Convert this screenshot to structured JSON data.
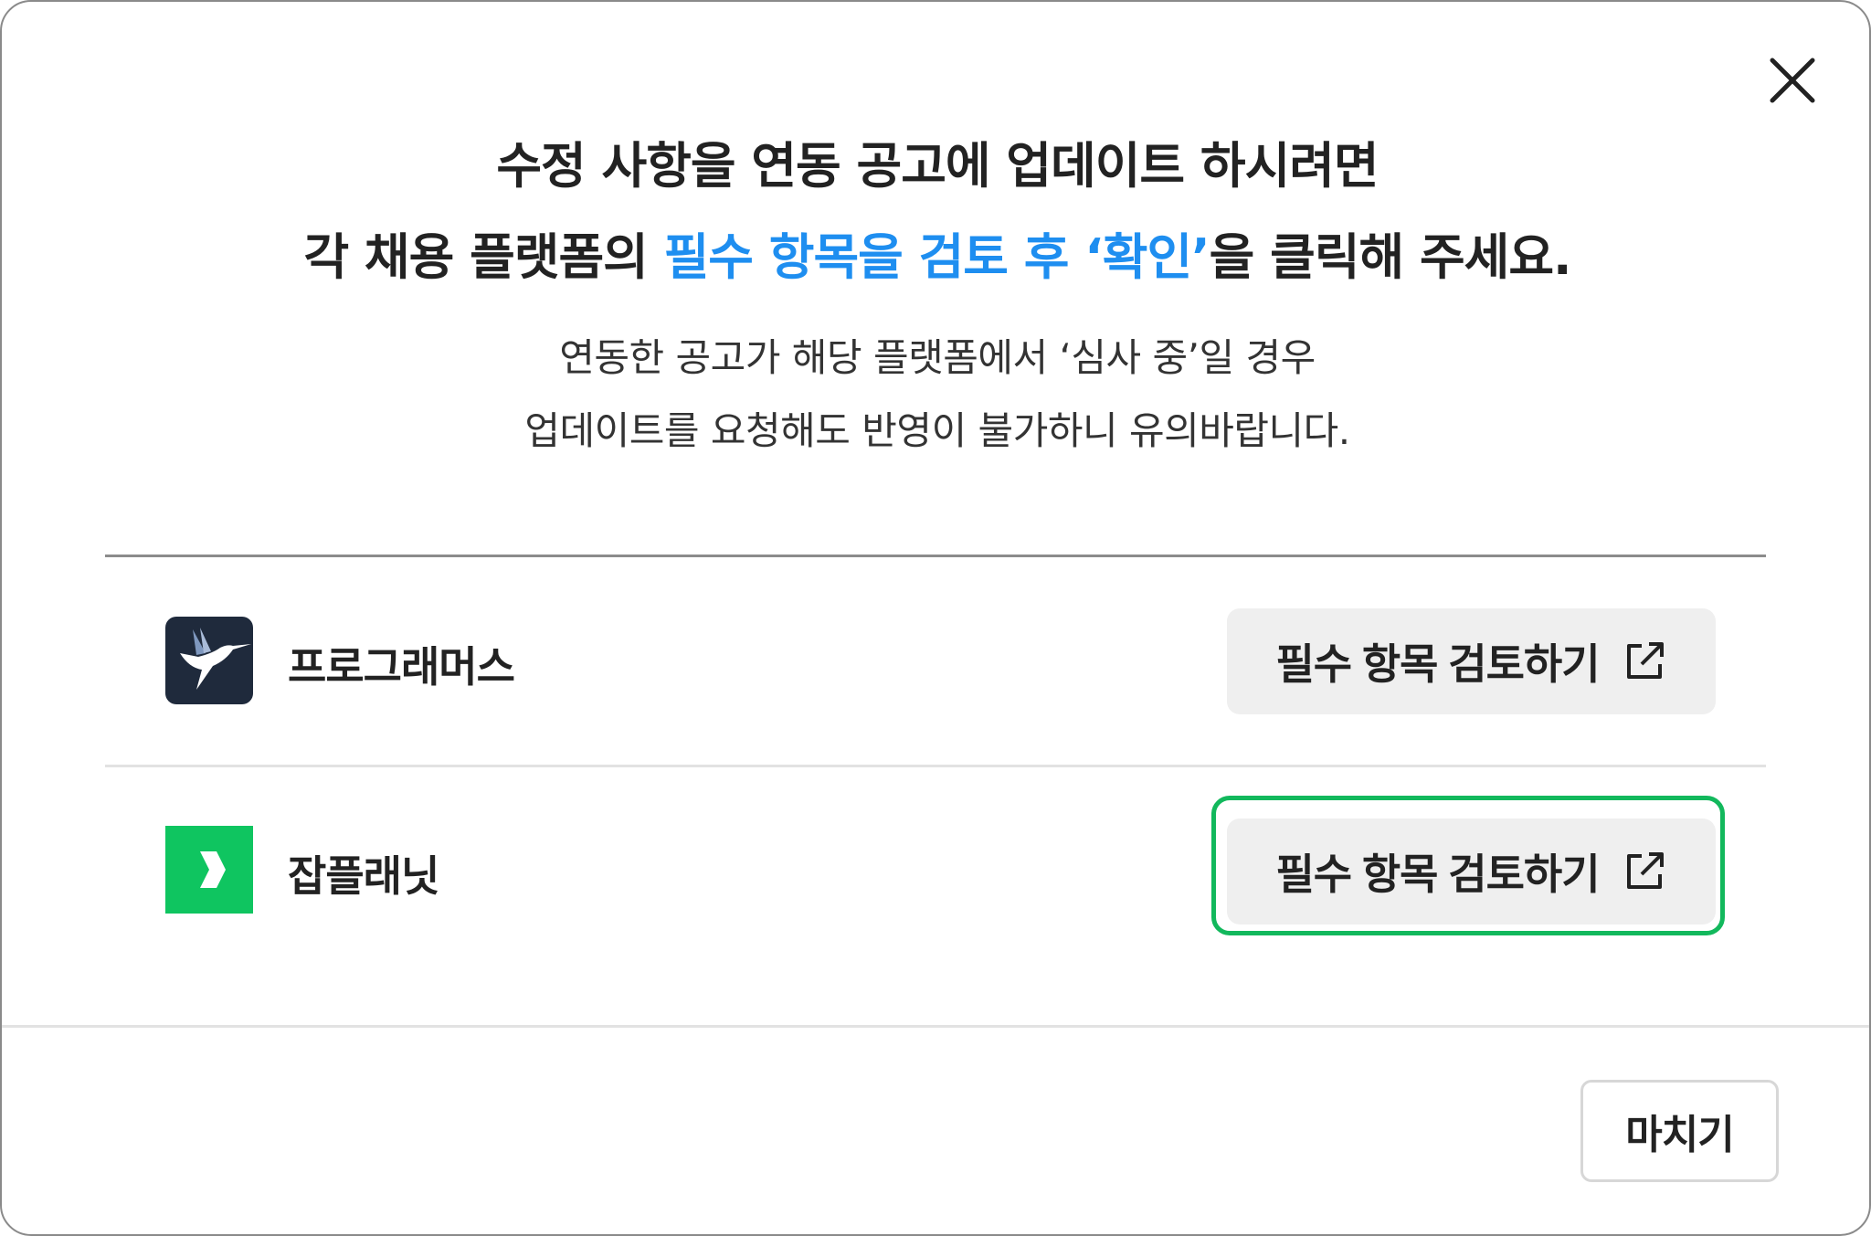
{
  "dialog": {
    "title_line1": "수정 사항을 연동 공고에 업데이트 하시려면",
    "title_line2_prefix": "각 채용 플랫폼의 ",
    "title_line2_highlight": "필수 항목을 검토 후 ‘확인’",
    "title_line2_suffix": "을 클릭해 주세요.",
    "subtitle_line1": "연동한 공고가 해당 플랫폼에서 ‘심사 중’일 경우",
    "subtitle_line2": "업데이트를 요청해도 반영이 불가하니 유의바랍니다.",
    "accent_color": "#1e8ef0"
  },
  "platforms": [
    {
      "name": "프로그래머스",
      "logo_icon": "hummingbird-icon",
      "logo_color": "#1f2a3c",
      "button_label": "필수 항목 검토하기",
      "button_icon": "external-link-icon"
    },
    {
      "name": "잡플래닛",
      "logo_icon": "chevron-right-icon",
      "logo_color": "#0fc560",
      "button_label": "필수 항목 검토하기",
      "button_icon": "external-link-icon",
      "highlight_color": "#12b85c"
    }
  ],
  "footer": {
    "close_label": "마치기"
  },
  "header": {
    "close_icon": "close-icon"
  }
}
